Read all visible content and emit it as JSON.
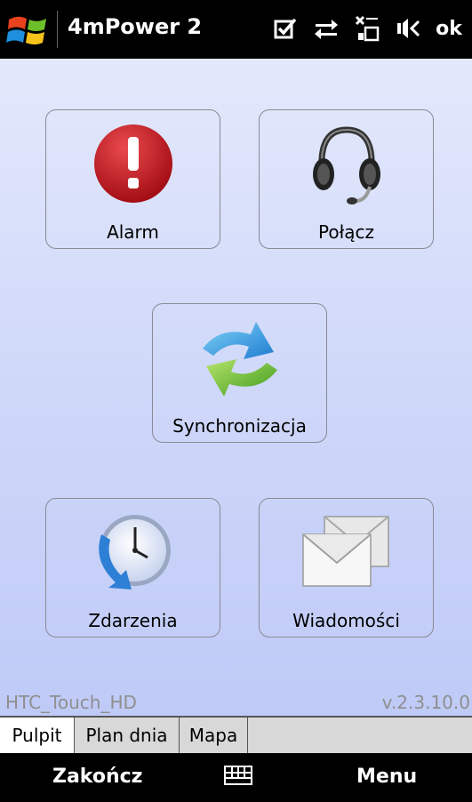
{
  "titlebar": {
    "app_title": "4mPower 2",
    "ok_label": "ok",
    "icons": [
      "windows-start-icon",
      "tasks-check-icon",
      "connectivity-icon",
      "no-signal-icon",
      "volume-icon"
    ]
  },
  "tiles": {
    "alarm": "Alarm",
    "connect": "Połącz",
    "sync": "Synchronizacja",
    "events": "Zdarzenia",
    "messages": "Wiadomości"
  },
  "footer": {
    "device": "HTC_Touch_HD",
    "version": "v.2.3.10.0"
  },
  "tabs": [
    {
      "label": "Pulpit",
      "active": true
    },
    {
      "label": "Plan dnia",
      "active": false
    },
    {
      "label": "Mapa",
      "active": false
    }
  ],
  "softkeys": {
    "left": "Zakończ",
    "right": "Menu"
  },
  "colors": {
    "titlebar_bg": "#000000",
    "content_bg_top": "#e3e8fb",
    "content_bg_bottom": "#bfcaf7",
    "alarm_red": "#c0161c"
  }
}
